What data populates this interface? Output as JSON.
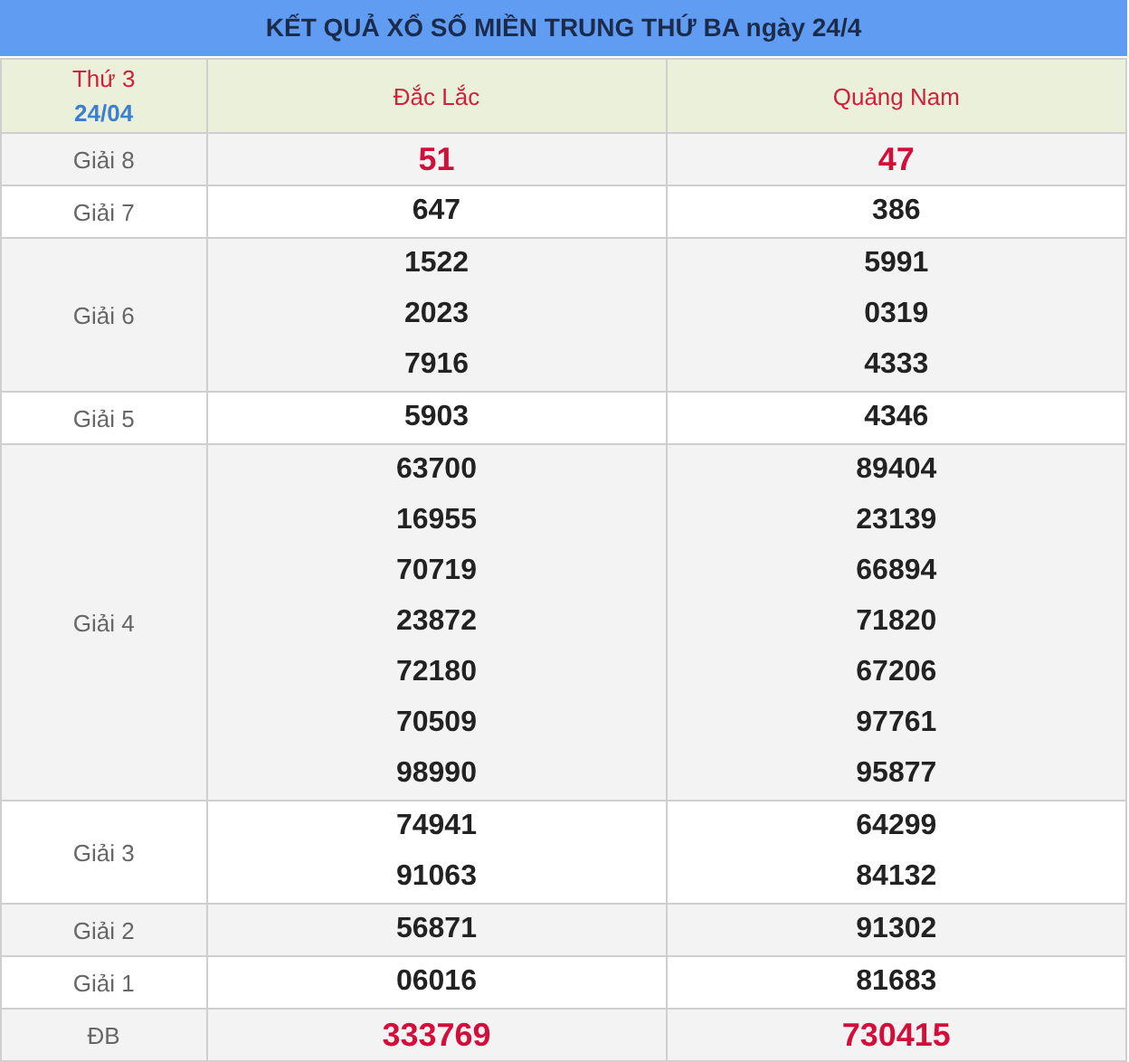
{
  "title": "KẾT QUẢ XỔ SỐ MIỀN TRUNG THỨ BA ngày 24/4",
  "header": {
    "day": "Thứ 3",
    "date": "24/04",
    "provinces": [
      "Đắc Lắc",
      "Quảng Nam"
    ]
  },
  "rows": [
    {
      "prize": "Giải 8",
      "highlight": true,
      "results": [
        [
          "51"
        ],
        [
          "47"
        ]
      ]
    },
    {
      "prize": "Giải 7",
      "highlight": false,
      "results": [
        [
          "647"
        ],
        [
          "386"
        ]
      ]
    },
    {
      "prize": "Giải 6",
      "highlight": false,
      "results": [
        [
          "1522",
          "2023",
          "7916"
        ],
        [
          "5991",
          "0319",
          "4333"
        ]
      ]
    },
    {
      "prize": "Giải 5",
      "highlight": false,
      "results": [
        [
          "5903"
        ],
        [
          "4346"
        ]
      ]
    },
    {
      "prize": "Giải 4",
      "highlight": false,
      "results": [
        [
          "63700",
          "16955",
          "70719",
          "23872",
          "72180",
          "70509",
          "98990"
        ],
        [
          "89404",
          "23139",
          "66894",
          "71820",
          "67206",
          "97761",
          "95877"
        ]
      ]
    },
    {
      "prize": "Giải 3",
      "highlight": false,
      "results": [
        [
          "74941",
          "91063"
        ],
        [
          "64299",
          "84132"
        ]
      ]
    },
    {
      "prize": "Giải 2",
      "highlight": false,
      "results": [
        [
          "56871"
        ],
        [
          "91302"
        ]
      ]
    },
    {
      "prize": "Giải 1",
      "highlight": false,
      "results": [
        [
          "06016"
        ],
        [
          "81683"
        ]
      ]
    },
    {
      "prize": "ĐB",
      "highlight": true,
      "results": [
        [
          "333769"
        ],
        [
          "730415"
        ]
      ]
    }
  ]
}
